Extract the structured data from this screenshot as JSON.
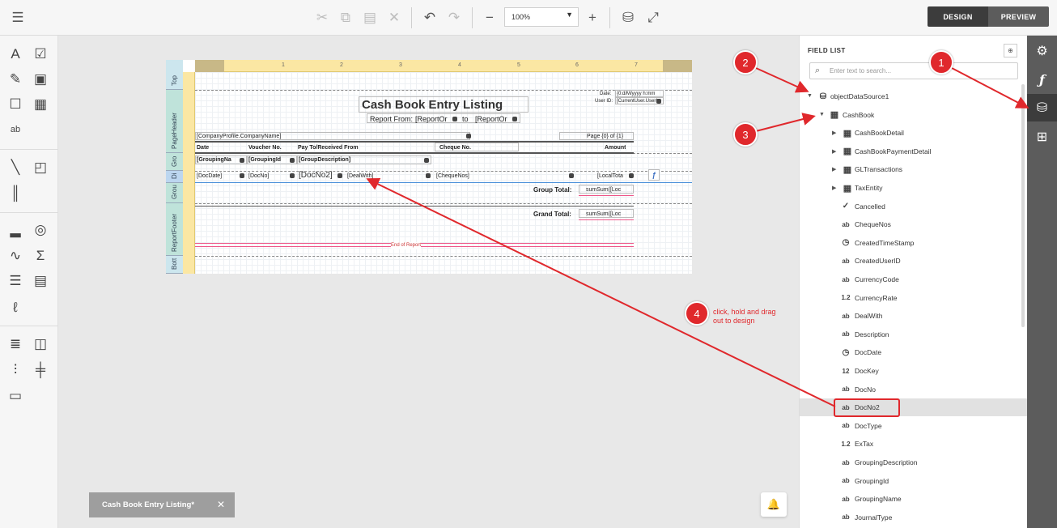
{
  "toolbar": {
    "menu_icon": "hamburger-icon",
    "zoom_value": "100%",
    "design_label": "DESIGN",
    "preview_label": "PREVIEW",
    "design_color": "#3c3c3c",
    "preview_color": "#5c5c5c"
  },
  "report": {
    "bands": [
      "Top",
      "PageHeader",
      "Gro",
      "Di",
      "Grou",
      "ReportFooter",
      "Bott"
    ],
    "ruler_numbers": [
      "1",
      "2",
      "3",
      "4",
      "5",
      "6",
      "7"
    ],
    "title": "Cash Book Entry Listing",
    "report_from": "Report From:",
    "report_from_field": "[ReportOr",
    "to_label": "to",
    "report_to_field": "[ReportOr",
    "date_label": "Date:",
    "date_value": "{0:d/M/yyyy h:mm",
    "userid_label": "User ID:",
    "userid_value": "[CurrentUser.UserI",
    "company": "[CompanyProfile.CompanyName]",
    "page_info": "Page {0} of {1}",
    "headers": [
      "Date",
      "Voucher No.",
      "Pay To/Received From",
      "Cheque No.",
      "Amount"
    ],
    "group_fields": [
      "[GroupingNa",
      "[GroupingId",
      "[GroupDescription]"
    ],
    "detail_fields": [
      "[DocDate]",
      "[DocNo]",
      "[DocNo2]",
      "[DealWith]",
      "[ChequeNos]",
      "[LocalTota"
    ],
    "group_total_label": "Group Total:",
    "group_total_field": "sumSum([Loc",
    "grand_total_label": "Grand Total:",
    "grand_total_field": "sumSum([Loc",
    "end_label": "End of Report"
  },
  "field_list": {
    "title": "FIELD LIST",
    "search_placeholder": "Enter text to search...",
    "root": "objectDataSource1",
    "table": "CashBook",
    "relations": [
      "CashBookDetail",
      "CashBookPaymentDetail",
      "GLTransactions",
      "TaxEntity"
    ],
    "fields": [
      {
        "type": "bool",
        "name": "Cancelled"
      },
      {
        "type": "ab",
        "name": "ChequeNos"
      },
      {
        "type": "time",
        "name": "CreatedTimeStamp"
      },
      {
        "type": "ab",
        "name": "CreatedUserID"
      },
      {
        "type": "ab",
        "name": "CurrencyCode"
      },
      {
        "type": "1.2",
        "name": "CurrencyRate"
      },
      {
        "type": "ab",
        "name": "DealWith"
      },
      {
        "type": "ab",
        "name": "Description"
      },
      {
        "type": "time",
        "name": "DocDate"
      },
      {
        "type": "12",
        "name": "DocKey"
      },
      {
        "type": "ab",
        "name": "DocNo"
      },
      {
        "type": "ab",
        "name": "DocNo2"
      },
      {
        "type": "ab",
        "name": "DocType"
      },
      {
        "type": "1.2",
        "name": "ExTax"
      },
      {
        "type": "ab",
        "name": "GroupingDescription"
      },
      {
        "type": "ab",
        "name": "GroupingId"
      },
      {
        "type": "ab",
        "name": "GroupingName"
      },
      {
        "type": "ab",
        "name": "JournalType"
      }
    ]
  },
  "doc_tab": {
    "label": "Cash Book Entry Listing*"
  },
  "annotations": {
    "callouts": [
      "1",
      "2",
      "3",
      "4"
    ],
    "instruction_line1": "click, hold and drag",
    "instruction_line2": "out to design",
    "accent": "#e0282c"
  }
}
